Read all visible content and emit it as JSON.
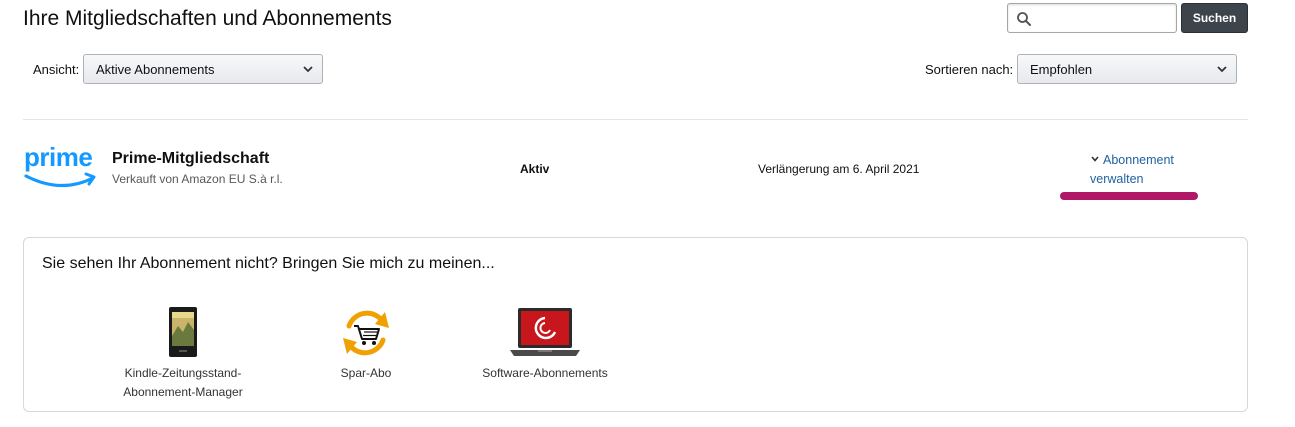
{
  "header": {
    "title": "Ihre Mitgliedschaften und Abonnements",
    "search": {
      "placeholder": "",
      "value": "",
      "button_label": "Suchen"
    }
  },
  "filters": {
    "view_label": "Ansicht:",
    "view_selected": "Aktive Abonnements",
    "sort_label": "Sortieren nach:",
    "sort_selected": "Empfohlen"
  },
  "subscription": {
    "logo_text": "prime",
    "name": "Prime-Mitgliedschaft",
    "seller": "Verkauft von Amazon EU S.à r.l.",
    "status": "Aktiv",
    "renewal": "Verlängerung am 6. April 2021",
    "manage_line1": "Abonnement",
    "manage_line2": "verwalten",
    "highlight_color": "#b01767"
  },
  "panel": {
    "title": "Sie sehen Ihr Abonnement nicht? Bringen Sie mich zu meinen...",
    "links": [
      {
        "line1": "Kindle-Zeitungsstand-",
        "line2": "Abonnement-Manager",
        "icon": "kindle-icon"
      },
      {
        "line1": "Spar-Abo",
        "line2": "",
        "icon": "subscribe-save-icon"
      },
      {
        "line1": "Software-Abonnements",
        "line2": "",
        "icon": "laptop-icon"
      }
    ]
  },
  "colors": {
    "link": "#2162a1",
    "prime_blue": "#1399ff",
    "button_dark": "#3e444c",
    "spar_orange": "#f0a000"
  }
}
